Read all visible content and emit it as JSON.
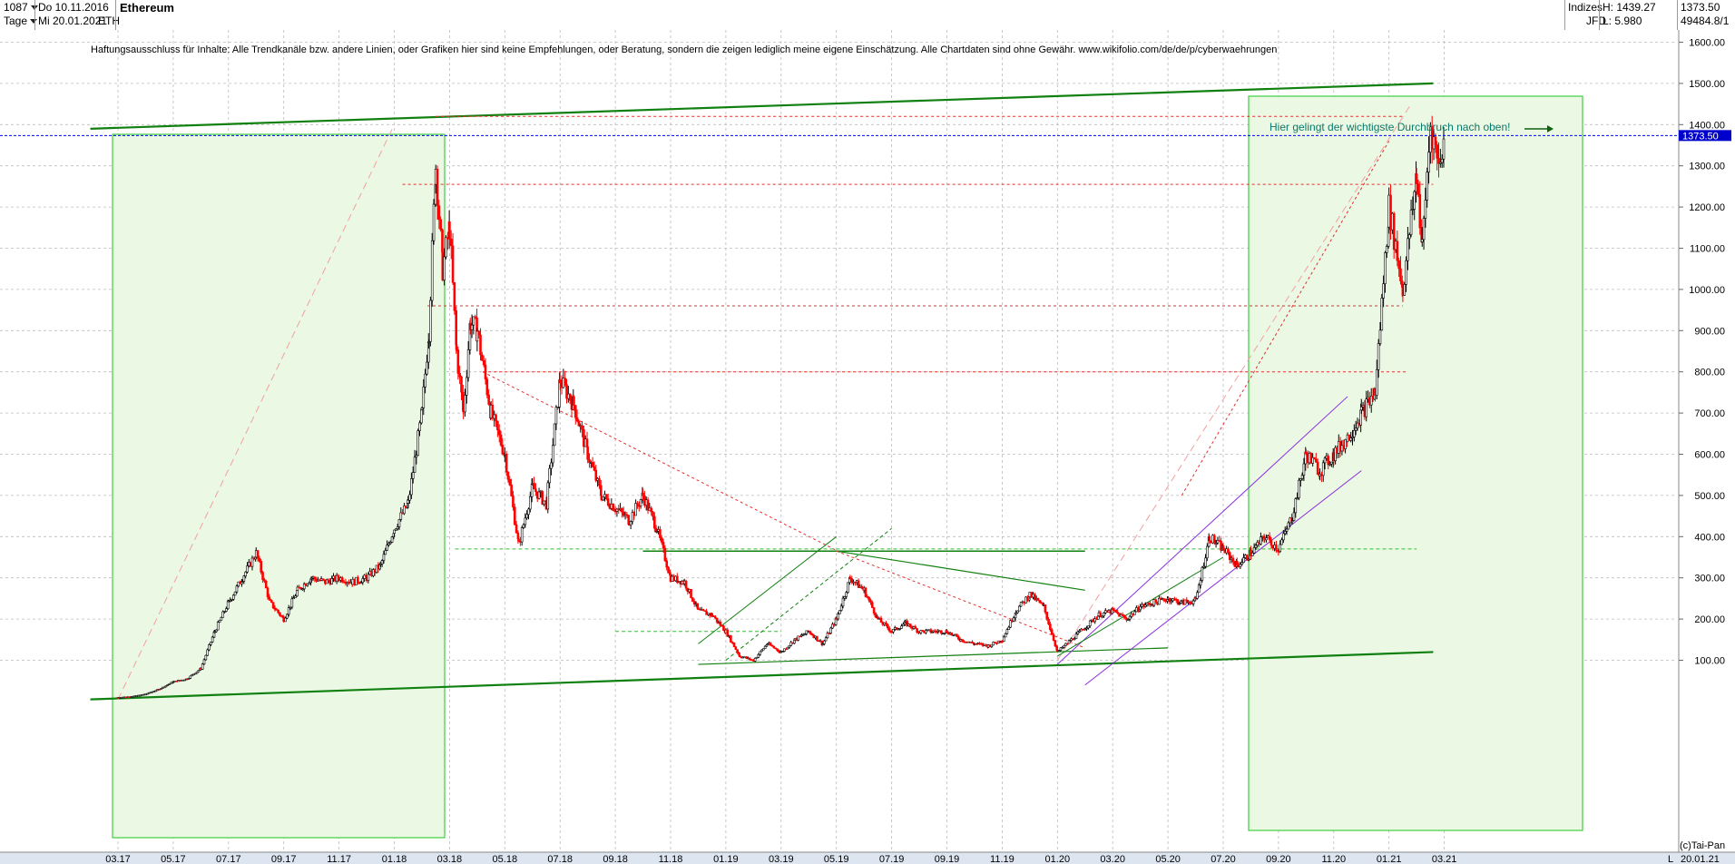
{
  "header": {
    "count": "1087",
    "start_date": "Do 10.11.2016",
    "period": "Tage",
    "end_date": "Mi 20.01.2021",
    "symbol": "ETH",
    "title": "Ethereum",
    "exchange": "Indizes",
    "source": "JFD",
    "high_label": "H: 1439.27",
    "low_label": "L: 5.980",
    "last_price": "1373.50",
    "volume": "49484.8/1"
  },
  "disclaimer": "Haftungsausschluss für Inhalte: Alle Trendkanäle bzw. andere Linien, oder Grafiken hier sind keine Empfehlungen, oder Beratung, sondern die zeigen lediglich meine eigene Einschätzung. Alle Chartdaten sind ohne Gewähr.  www.wikifolio.com/de/de/p/cyberwaehrungen",
  "annotation": "Hier gelingt der wichtigste Durchbruch nach oben!",
  "footer": {
    "copyright": "(c)Tai-Pan",
    "date": "20.01.21",
    "scale_mode": "L"
  },
  "colors": {
    "up": "#000000",
    "down": "#ff0000",
    "price_line": "#0000ff",
    "support": "#008000",
    "channel_fill": "#eaf8e4"
  },
  "chart_data": {
    "type": "candlestick",
    "title": "Ethereum",
    "current_price": 1373.5,
    "ylim": [
      0,
      1650
    ],
    "yticks": [
      "1600.00",
      "1500.00",
      "1400.00",
      "1300.00",
      "1200.00",
      "1100.00",
      "1000.00",
      "900.00",
      "800.00",
      "700.00",
      "600.00",
      "500.00",
      "400.00",
      "300.00",
      "200.00",
      "100.00"
    ],
    "xticks": [
      "03.17",
      "05.17",
      "07.17",
      "09.17",
      "11.17",
      "01.18",
      "03.18",
      "05.18",
      "07.18",
      "09.18",
      "11.18",
      "01.19",
      "03.19",
      "05.19",
      "07.19",
      "09.19",
      "11.19",
      "01.20",
      "03.20",
      "05.20",
      "07.20",
      "09.20",
      "11.20",
      "01.21",
      "03.21"
    ],
    "grid": true,
    "series": [
      {
        "x": [
          0,
          0.5,
          1,
          1.5,
          2,
          2.5,
          3,
          3.5,
          4,
          4.5,
          5,
          5.5,
          6,
          6.5,
          7,
          7.5,
          8,
          8.5,
          9,
          9.5,
          10,
          10.5,
          11,
          11.25,
          11.5,
          11.75,
          12,
          12.25,
          12.5,
          12.75,
          13,
          13.5,
          14,
          14.5,
          15,
          15.5,
          16,
          16.5,
          17,
          17.5,
          18,
          18.5,
          19,
          19.5,
          20,
          20.5,
          21,
          21.5,
          22,
          22.5,
          23,
          23.5,
          24,
          24.5,
          25,
          25.5,
          26,
          26.5,
          27,
          27.5,
          28,
          28.5,
          29,
          29.5,
          30,
          30.5,
          31,
          31.5,
          32,
          32.5,
          33,
          33.5,
          34,
          34.5,
          35,
          35.5,
          36,
          36.5,
          37,
          37.5,
          38,
          38.5,
          39,
          39.5,
          40,
          40.5,
          41,
          41.5,
          42,
          42.5,
          43,
          43.5,
          44,
          44.5,
          45,
          45.5,
          46,
          46.5,
          47,
          47.2,
          47.5,
          47.8,
          48
        ],
        "values": [
          10,
          12,
          18,
          30,
          48,
          55,
          80,
          170,
          240,
          300,
          360,
          240,
          200,
          270,
          300,
          290,
          300,
          290,
          300,
          330,
          420,
          480,
          700,
          900,
          1300,
          1050,
          1150,
          850,
          700,
          920,
          900,
          700,
          600,
          380,
          520,
          480,
          780,
          720,
          600,
          500,
          470,
          440,
          500,
          420,
          300,
          290,
          220,
          210,
          170,
          110,
          100,
          140,
          120,
          150,
          170,
          140,
          200,
          300,
          270,
          200,
          170,
          190,
          170,
          170,
          170,
          150,
          140,
          135,
          150,
          220,
          260,
          230,
          120,
          150,
          180,
          210,
          220,
          200,
          230,
          240,
          250,
          240,
          245,
          400,
          370,
          330,
          360,
          400,
          370,
          450,
          600,
          560,
          600,
          640,
          700,
          750,
          1200,
          1000,
          1280,
          1100,
          1400,
          1300,
          1373.5
        ]
      }
    ]
  }
}
